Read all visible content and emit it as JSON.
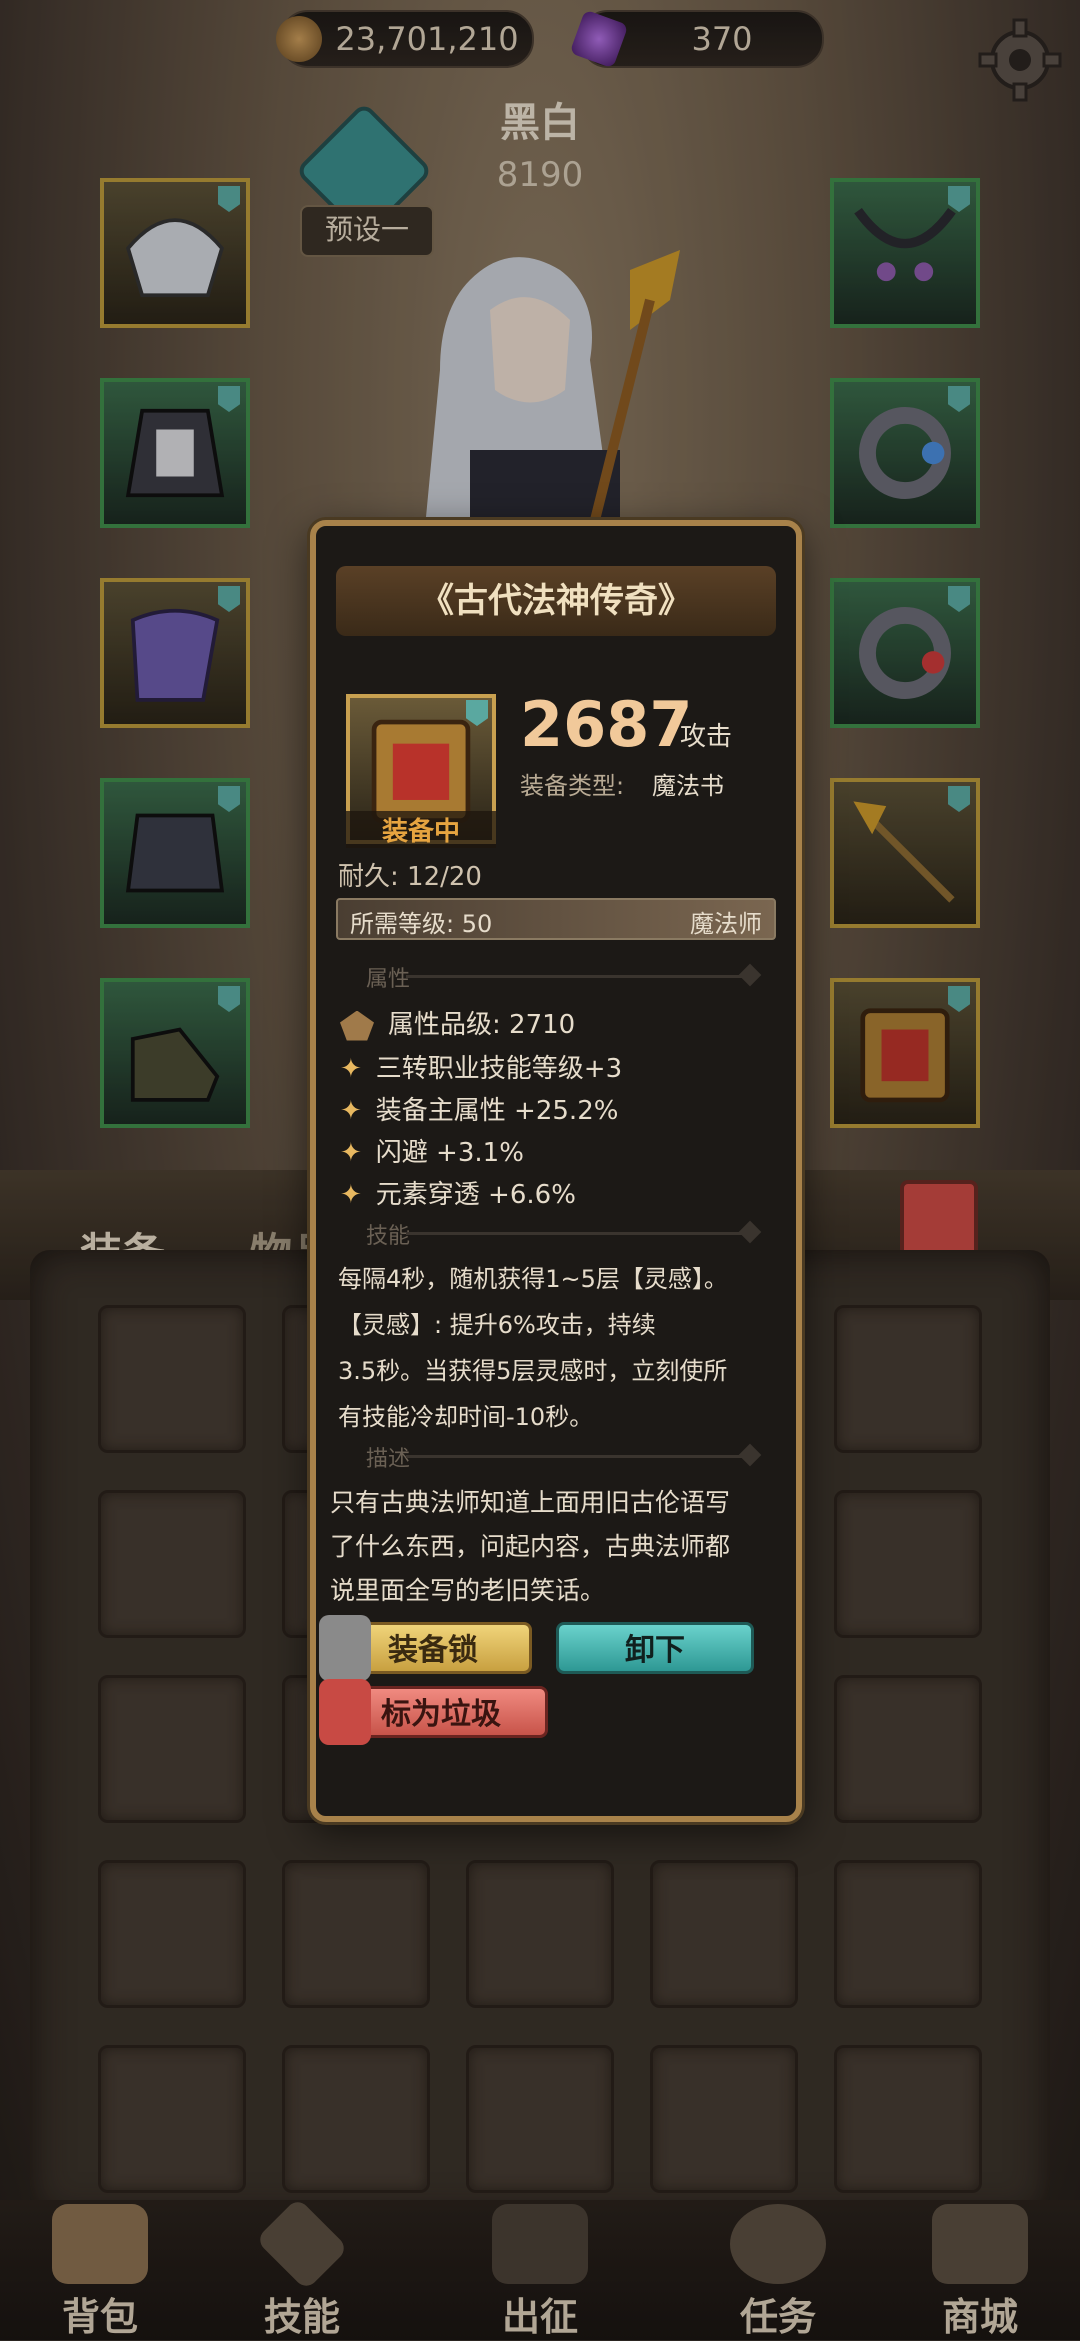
{
  "resources": {
    "gold": "23,701,210",
    "gems": "370"
  },
  "hero": {
    "name": "黑白",
    "power": "8190",
    "preset": "预设一"
  },
  "tabs": {
    "equip": "装备",
    "items": "物品"
  },
  "item": {
    "title": "《古代法神传奇》",
    "stat_value": "2687",
    "stat_unit": "攻击",
    "type_label": "装备类型:",
    "type_value": "魔法书",
    "equipped_label": "装备中",
    "durability": "耐久: 12/20",
    "req_level": "所需等级: 50",
    "req_class": "魔法师",
    "section_attr": "属性",
    "grade": "属性品级: 2710",
    "attrs": [
      "三转职业技能等级+3",
      "装备主属性 +25.2%",
      "闪避 +3.1%",
      "元素穿透 +6.6%"
    ],
    "section_skill": "技能",
    "skill_lines": [
      "每隔4秒，随机获得1~5层【灵感】。",
      "【灵感】: 提升6%攻击，持续",
      "3.5秒。当获得5层灵感时，立刻使所",
      "有技能冷却时间-10秒。"
    ],
    "section_desc": "描述",
    "desc_lines": [
      "只有古典法师知道上面用旧古伦语写",
      "了什么东西，问起内容，古典法师都",
      "说里面全写的老旧笑话。"
    ],
    "btn_lock": "装备锁",
    "btn_unequip": "卸下",
    "btn_trash": "标为垃圾"
  },
  "nav": [
    {
      "label": "背包",
      "icon": "backpack-icon"
    },
    {
      "label": "技能",
      "icon": "skill-icon"
    },
    {
      "label": "出征",
      "icon": "sword-icon"
    },
    {
      "label": "任务",
      "icon": "quest-icon"
    },
    {
      "label": "商城",
      "icon": "shop-icon"
    }
  ],
  "colors": {
    "accent_gold": "#c8a050",
    "accent_teal": "#3fa8a0",
    "stat_value": "#f1c99a"
  }
}
